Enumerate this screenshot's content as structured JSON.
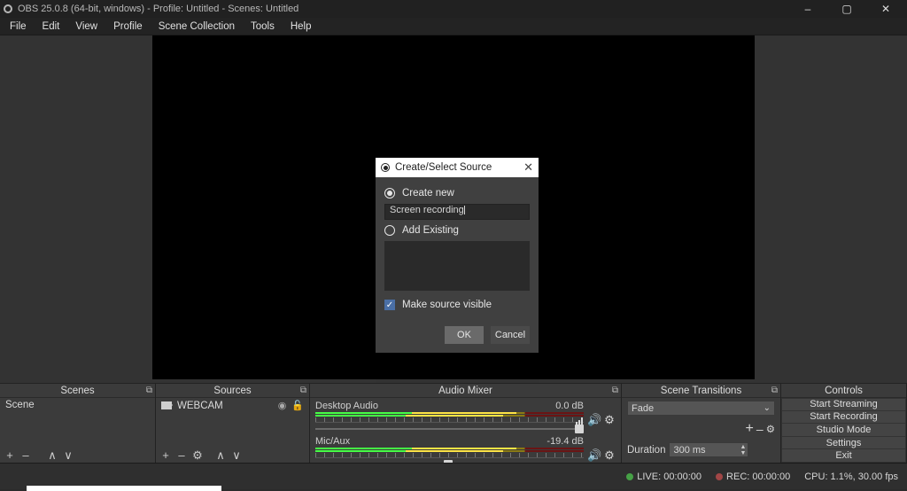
{
  "titlebar": {
    "text": "OBS 25.0.8 (64-bit, windows) - Profile: Untitled - Scenes: Untitled"
  },
  "menubar": [
    "File",
    "Edit",
    "View",
    "Profile",
    "Scene Collection",
    "Tools",
    "Help"
  ],
  "panels": {
    "scenes": {
      "title": "Scenes",
      "items": [
        "Scene"
      ]
    },
    "sources": {
      "title": "Sources",
      "items": [
        "WEBCAM"
      ]
    },
    "mixer": {
      "title": "Audio Mixer",
      "channels": [
        {
          "name": "Desktop Audio",
          "db": "0.0 dB",
          "slider_pct": 100
        },
        {
          "name": "Mic/Aux",
          "db": "-19.4 dB",
          "slider_pct": 50
        }
      ]
    },
    "transitions": {
      "title": "Scene Transitions",
      "selected": "Fade",
      "duration_label": "Duration",
      "duration_value": "300 ms"
    },
    "controls": {
      "title": "Controls",
      "buttons": [
        "Start Streaming",
        "Start Recording",
        "Studio Mode",
        "Settings",
        "Exit"
      ]
    }
  },
  "status": {
    "live_label": "LIVE:",
    "live_time": "00:00:00",
    "rec_label": "REC:",
    "rec_time": "00:00:00",
    "cpu": "CPU: 1.1%, 30.00 fps",
    "live_color": "#46a146",
    "rec_color": "#a14646"
  },
  "modal": {
    "title": "Create/Select Source",
    "create_new_label": "Create new",
    "input_value": "Screen recording",
    "add_existing_label": "Add Existing",
    "make_visible_label": "Make source visible",
    "ok": "OK",
    "cancel": "Cancel"
  }
}
